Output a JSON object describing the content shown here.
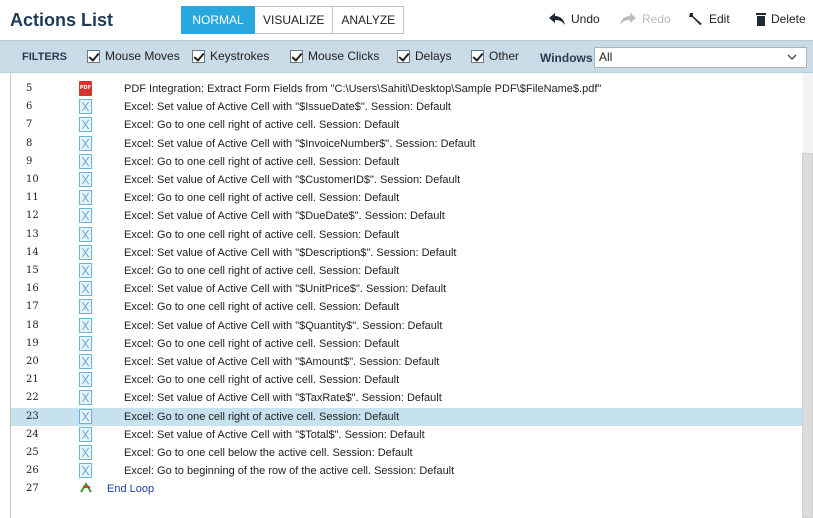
{
  "header": {
    "title": "Actions List",
    "modes": [
      "NORMAL",
      "VISUALIZE",
      "ANALYZE"
    ],
    "active_mode": "NORMAL",
    "tools": {
      "undo": "Undo",
      "redo": "Redo",
      "edit": "Edit",
      "delete": "Delete"
    }
  },
  "filters": {
    "label": "FILTERS",
    "checkboxes": [
      "Mouse Moves",
      "Keystrokes",
      "Mouse Clicks",
      "Delays",
      "Other"
    ],
    "windows_label": "Windows",
    "windows_value": "All"
  },
  "colors": {
    "accent": "#29a8e0",
    "filter_bar": "#c9dbe6",
    "selected_row": "#c6e2ee",
    "loop_text": "#1a3fa6"
  },
  "actions": [
    {
      "num": "5",
      "icon": "pdf-icon",
      "text": "PDF Integration: Extract Form Fields from \"C:\\Users\\Sahiti\\Desktop\\Sample PDF\\$FileName$.pdf\""
    },
    {
      "num": "6",
      "icon": "excel-icon",
      "text": "Excel: Set value of Active Cell with \"$IssueDate$\". Session: Default"
    },
    {
      "num": "7",
      "icon": "excel-icon",
      "text": "Excel: Go to one cell right of active cell. Session: Default"
    },
    {
      "num": "8",
      "icon": "excel-icon",
      "text": "Excel: Set value of Active Cell with \"$InvoiceNumber$\". Session: Default"
    },
    {
      "num": "9",
      "icon": "excel-icon",
      "text": "Excel: Go to one cell right of active cell. Session: Default"
    },
    {
      "num": "10",
      "icon": "excel-icon",
      "text": "Excel: Set value of Active Cell with \"$CustomerID$\". Session: Default"
    },
    {
      "num": "11",
      "icon": "excel-icon",
      "text": "Excel: Go to one cell right of active cell. Session: Default"
    },
    {
      "num": "12",
      "icon": "excel-icon",
      "text": "Excel: Set value of Active Cell with \"$DueDate$\". Session: Default"
    },
    {
      "num": "13",
      "icon": "excel-icon",
      "text": "Excel: Go to one cell right of active cell. Session: Default"
    },
    {
      "num": "14",
      "icon": "excel-icon",
      "text": "Excel: Set value of Active Cell with \"$Description$\". Session: Default"
    },
    {
      "num": "15",
      "icon": "excel-icon",
      "text": "Excel: Go to one cell right of active cell. Session: Default"
    },
    {
      "num": "16",
      "icon": "excel-icon",
      "text": "Excel: Set value of Active Cell with \"$UnitPrice$\". Session: Default"
    },
    {
      "num": "17",
      "icon": "excel-icon",
      "text": "Excel: Go to one cell right of active cell. Session: Default"
    },
    {
      "num": "18",
      "icon": "excel-icon",
      "text": "Excel: Set value of Active Cell with \"$Quantity$\". Session: Default"
    },
    {
      "num": "19",
      "icon": "excel-icon",
      "text": "Excel: Go to one cell right of active cell. Session: Default"
    },
    {
      "num": "20",
      "icon": "excel-icon",
      "text": "Excel: Set value of Active Cell with \"$Amount$\". Session: Default"
    },
    {
      "num": "21",
      "icon": "excel-icon",
      "text": "Excel: Go to one cell right of active cell. Session: Default"
    },
    {
      "num": "22",
      "icon": "excel-icon",
      "text": "Excel: Set value of Active Cell with \"$TaxRate$\". Session: Default"
    },
    {
      "num": "23",
      "icon": "excel-icon",
      "text": "Excel: Go to one cell right of active cell. Session: Default",
      "selected": true
    },
    {
      "num": "24",
      "icon": "excel-icon",
      "text": "Excel: Set value of Active Cell with \"$Total$\". Session: Default"
    },
    {
      "num": "25",
      "icon": "excel-icon",
      "text": "Excel: Go to one cell below the active cell. Session: Default"
    },
    {
      "num": "26",
      "icon": "excel-icon",
      "text": "Excel: Go to beginning of the row of the active cell. Session: Default"
    },
    {
      "num": "27",
      "icon": "end-loop-icon",
      "text": "End Loop"
    }
  ]
}
